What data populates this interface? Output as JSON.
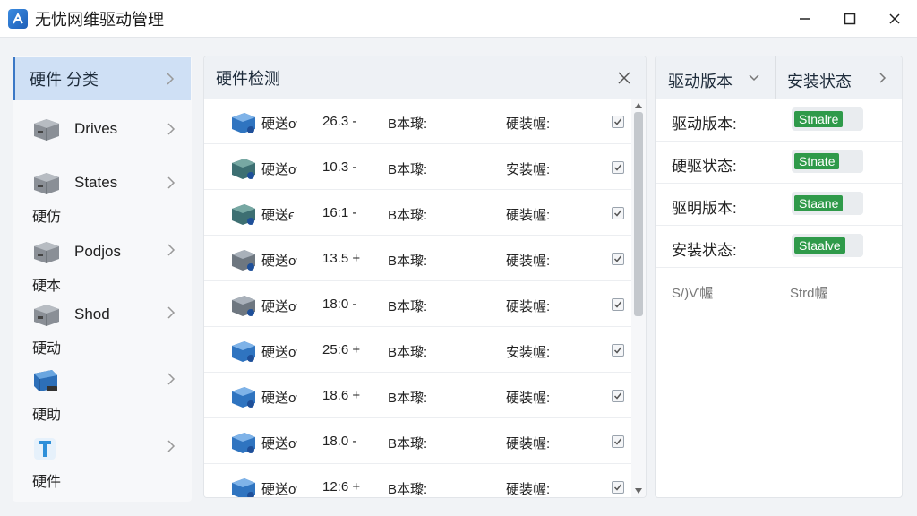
{
  "window": {
    "title": "无忧网维驱动管理",
    "icon": "app-logo-icon",
    "controls": [
      "minimize-icon",
      "maximize-icon",
      "close-icon"
    ]
  },
  "sidebar": {
    "header": "硬件 分类",
    "items": [
      {
        "label": "Drives",
        "sub": "",
        "icon": "drive-icon"
      },
      {
        "label": "States",
        "sub": "硬仿",
        "icon": "drive-icon"
      },
      {
        "label": "Podjos",
        "sub": "硬本",
        "icon": "drive-icon"
      },
      {
        "label": "Shod",
        "sub": "硬动",
        "icon": "drive-icon"
      },
      {
        "label": "",
        "sub": "硬助",
        "icon": "network-drive-icon"
      },
      {
        "label": "",
        "sub": "硬件",
        "icon": "text-t-icon"
      }
    ]
  },
  "center": {
    "title": "硬件检测",
    "rows": [
      {
        "name": "硬送ơ",
        "version": "26.3 -",
        "col3": "B本瓈:",
        "col4": "硬装幄:",
        "icon": "blue"
      },
      {
        "name": "硬送ơ",
        "version": "10.3 -",
        "col3": "B本瓈:",
        "col4": "安装幄:",
        "icon": "green"
      },
      {
        "name": "硬送ϵ",
        "version": "16:1 -",
        "col3": "B本瓈:",
        "col4": "硬装幄:",
        "icon": "green"
      },
      {
        "name": "硬送ơ",
        "version": "13.5 +",
        "col3": "B本瓈:",
        "col4": "硬装幄:",
        "icon": "grey"
      },
      {
        "name": "硬送ơ",
        "version": "18:0 -",
        "col3": "B本瓈:",
        "col4": "硬装幄:",
        "icon": "grey"
      },
      {
        "name": "硬送ơ",
        "version": "25:6 +",
        "col3": "B本瓈:",
        "col4": "安装幄:",
        "icon": "blue"
      },
      {
        "name": "硬送ơ",
        "version": "18.6 +",
        "col3": "B本瓈:",
        "col4": "硬装幄:",
        "icon": "blue"
      },
      {
        "name": "硬送ơ",
        "version": "18.0 -",
        "col3": "B本瓈:",
        "col4": "硬装幄:",
        "icon": "blue"
      },
      {
        "name": "硬送ơ",
        "version": "12:6 +",
        "col3": "B本瓈:",
        "col4": "硬装幄:",
        "icon": "blue"
      }
    ]
  },
  "right": {
    "tab1": "驱动版本",
    "tab2": "安装状态",
    "rows": [
      {
        "label": "驱动版本:",
        "badge": "Stnalre"
      },
      {
        "label": "硬驱状态:",
        "badge": "Stnate"
      },
      {
        "label": "驱明版本:",
        "badge": "Staane"
      },
      {
        "label": "安装状态:",
        "badge": "Staalve"
      }
    ],
    "footer_left": "S/)Ѵ幄",
    "footer_right": "Strd幄"
  },
  "colors": {
    "accent": "#3b78c6",
    "selected_bg": "#cfe0f5",
    "badge_green": "#2f9a4a"
  }
}
